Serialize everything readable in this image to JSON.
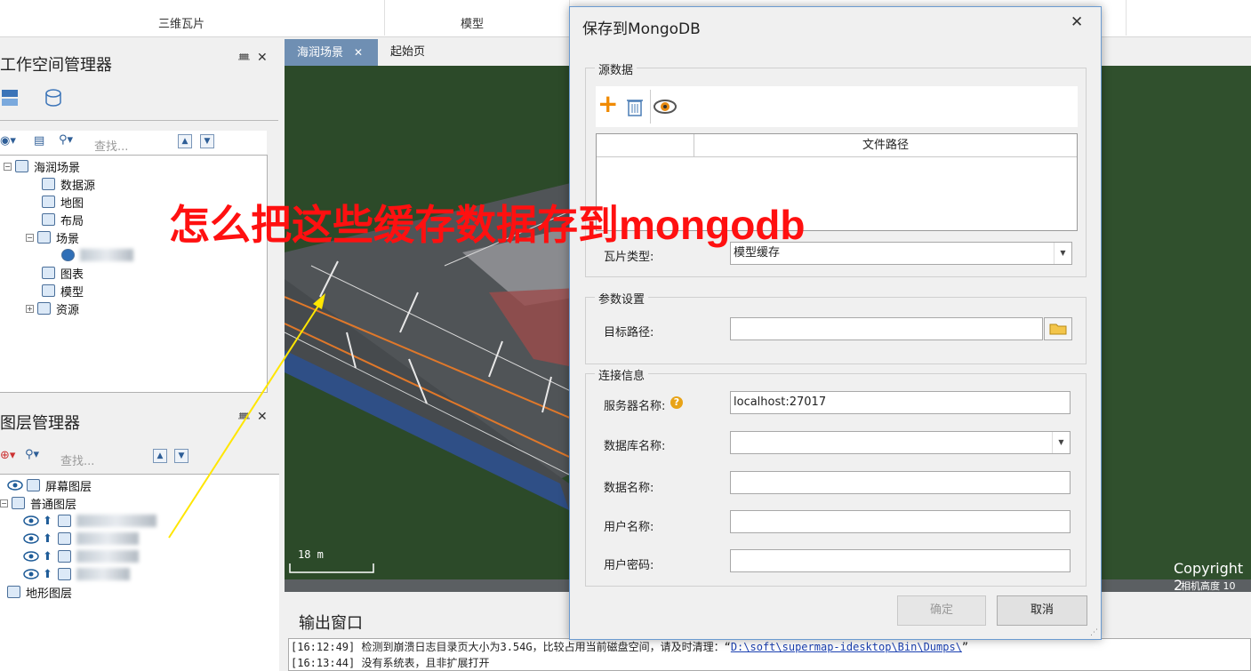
{
  "ribbon": {
    "groups": [
      "三维瓦片",
      "模型"
    ]
  },
  "workspace": {
    "title": "工作空间管理器",
    "search_placeholder": "查找...",
    "tree": [
      {
        "label": "海润场景",
        "icon": "scene-workspace-icon"
      },
      {
        "label": "数据源",
        "icon": "datasource-icon"
      },
      {
        "label": "地图",
        "icon": "map-icon"
      },
      {
        "label": "布局",
        "icon": "layout-icon"
      },
      {
        "label": "场景",
        "icon": "scene-icon"
      },
      {
        "label": "图表",
        "icon": "chart-icon"
      },
      {
        "label": "模型",
        "icon": "model-icon"
      },
      {
        "label": "资源",
        "icon": "resource-icon"
      }
    ]
  },
  "layers": {
    "title": "图层管理器",
    "search_placeholder": "查找...",
    "items": [
      {
        "label": "屏幕图层"
      },
      {
        "label": "普通图层"
      },
      {
        "label": "地形图层"
      }
    ]
  },
  "tabs": [
    {
      "label": "海润场景",
      "close": "✕"
    },
    {
      "label": "起始页"
    }
  ],
  "scene": {
    "scale_label": "18 m",
    "copyright": "Copyright 2",
    "camera_height": "相机高度 10"
  },
  "annotation": "怎么把这些缓存数据存到mongodb",
  "output": {
    "title": "输出窗口",
    "lines": [
      {
        "text": "[16:12:49] 检测到崩溃日志目录页大小为3.54G，比较占用当前磁盘空间，请及时清理：“",
        "link": "D:\\soft\\supermap-idesktop\\Bin\\Dumps\\",
        "suffix": "”"
      },
      {
        "text": "[16:13:44] 没有系统表，且非扩展打开"
      }
    ]
  },
  "dialog": {
    "title": "保存到MongoDB",
    "source_group": "源数据",
    "file_path_header": "文件路径",
    "tile_type_label": "瓦片类型:",
    "tile_type_value": "模型缓存",
    "params_group": "参数设置",
    "target_path_label": "目标路径:",
    "target_path_value": "",
    "conn_group": "连接信息",
    "server_label": "服务器名称:",
    "server_value": "localhost:27017",
    "database_label": "数据库名称:",
    "data_name_label": "数据名称:",
    "user_label": "用户名称:",
    "password_label": "用户密码:",
    "ok": "确定",
    "cancel": "取消"
  },
  "colors": {
    "annotation": "#ff1010",
    "dialog_border": "#6b9bd1",
    "link": "#1a3fb0"
  }
}
